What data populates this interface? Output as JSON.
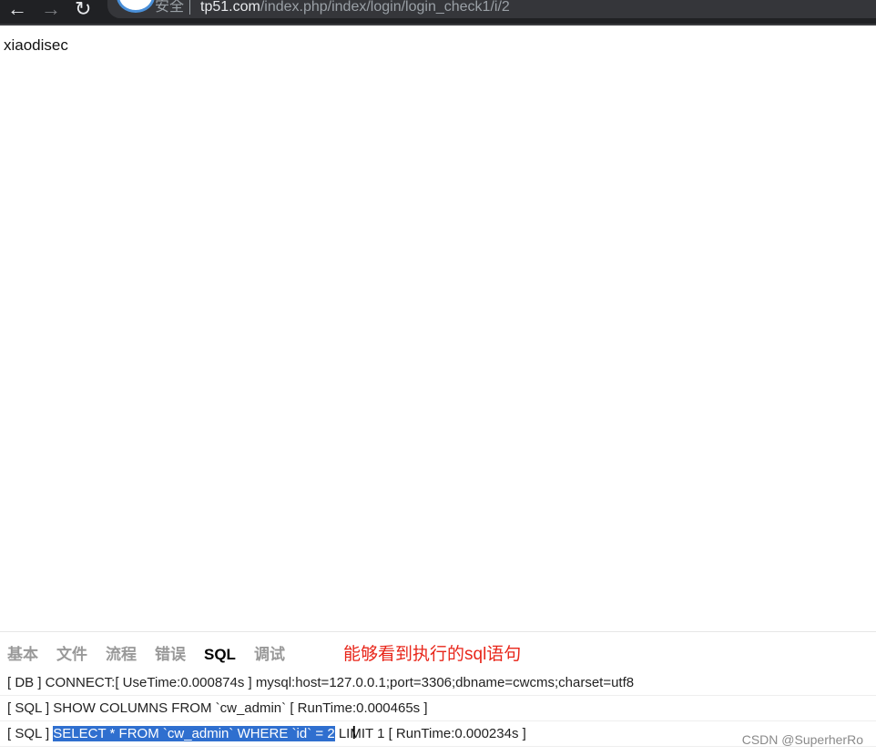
{
  "browser": {
    "security_label": "安全",
    "url_domain": "tp51.com",
    "url_path": "/index.php/index/login/login_check1/i/2"
  },
  "page": {
    "output_text": "xiaodisec"
  },
  "trace_panel": {
    "tabs": [
      "基本",
      "文件",
      "流程",
      "错误",
      "SQL",
      "调试"
    ],
    "active_tab": "SQL",
    "annotation": "能够看到执行的sql语句",
    "lines": [
      "[ DB ] CONNECT:[ UseTime:0.000874s ] mysql:host=127.0.0.1;port=3306;dbname=cwcms;charset=utf8",
      "[ SQL ] SHOW COLUMNS FROM `cw_admin` [ RunTime:0.000465s ]"
    ],
    "line3_prefix": "[ SQL ] ",
    "line3_selected": "SELECT * FROM `cw_admin` WHERE `id` = 2",
    "line3_rest": " LIMIT 1 [ RunTime:0.000234s ]"
  },
  "watermark": "CSDN @SuperherRo",
  "colors": {
    "selection": "#2f6fcf",
    "annotation": "#e8261a",
    "chrome_bg": "#202124"
  }
}
